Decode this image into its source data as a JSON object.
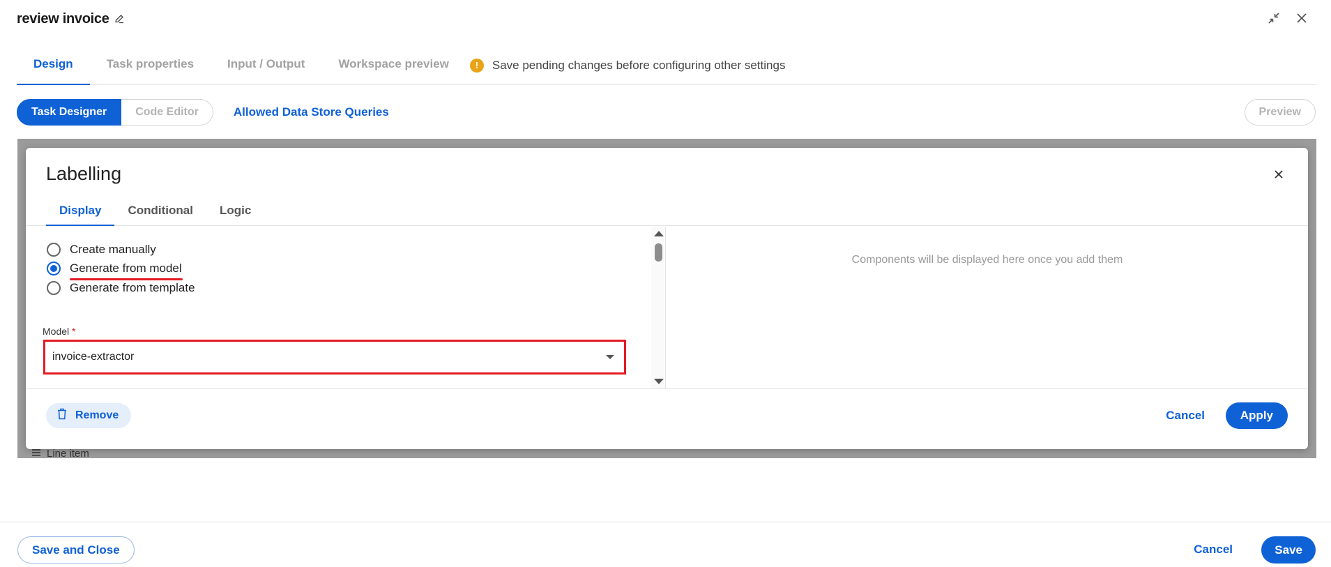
{
  "header": {
    "title": "review invoice",
    "edit_icon": "pencil-icon",
    "collapse_icon": "collapse-arrows-icon",
    "close_icon": "close-icon"
  },
  "tabs": [
    {
      "label": "Design",
      "active": true
    },
    {
      "label": "Task properties",
      "active": false
    },
    {
      "label": "Input / Output",
      "active": false
    },
    {
      "label": "Workspace preview",
      "active": false
    }
  ],
  "pending_notice": {
    "icon": "warning-icon",
    "icon_glyph": "!",
    "text": "Save pending changes before configuring other settings",
    "color": "#e8a317"
  },
  "toolbar": {
    "task_designer": "Task Designer",
    "code_editor": "Code Editor",
    "allowed_queries": "Allowed Data Store Queries",
    "preview": "Preview"
  },
  "canvas": {
    "peek_item": "Line item"
  },
  "dialog": {
    "title": "Labelling",
    "tabs": [
      "Display",
      "Conditional",
      "Logic"
    ],
    "active_tab": "Display",
    "radio_options": [
      {
        "label": "Create manually",
        "checked": false
      },
      {
        "label": "Generate from model",
        "checked": true
      },
      {
        "label": "Generate from template",
        "checked": false
      }
    ],
    "model_label": "Model",
    "model_required_marker": "*",
    "model_value": "invoice-extractor",
    "empty_components_text": "Components will be displayed here once you add them",
    "remove_label": "Remove",
    "cancel_label": "Cancel",
    "apply_label": "Apply"
  },
  "footer": {
    "save_close_label": "Save and Close",
    "cancel_label": "Cancel",
    "save_label": "Save"
  },
  "colors": {
    "accent": "#0f61d6",
    "highlight": "#e31b23",
    "overlay": "#9b9b9b"
  }
}
